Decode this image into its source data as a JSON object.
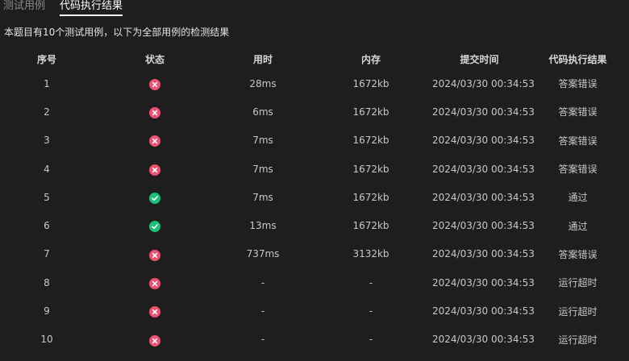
{
  "tabs": [
    {
      "label": "测试用例",
      "active": false
    },
    {
      "label": "代码执行结果",
      "active": true
    }
  ],
  "summary": "本题目有10个测试用例，以下为全部用例的检测结果",
  "columns": [
    "序号",
    "状态",
    "用时",
    "内存",
    "提交时间",
    "代码执行结果"
  ],
  "rows": [
    {
      "index": "1",
      "status": "fail",
      "time": "28ms",
      "memory": "1672kb",
      "submitted": "2024/03/30 00:34:53",
      "result": "答案错误"
    },
    {
      "index": "2",
      "status": "fail",
      "time": "6ms",
      "memory": "1672kb",
      "submitted": "2024/03/30 00:34:53",
      "result": "答案错误"
    },
    {
      "index": "3",
      "status": "fail",
      "time": "7ms",
      "memory": "1672kb",
      "submitted": "2024/03/30 00:34:53",
      "result": "答案错误"
    },
    {
      "index": "4",
      "status": "fail",
      "time": "7ms",
      "memory": "1672kb",
      "submitted": "2024/03/30 00:34:53",
      "result": "答案错误"
    },
    {
      "index": "5",
      "status": "pass",
      "time": "7ms",
      "memory": "1672kb",
      "submitted": "2024/03/30 00:34:53",
      "result": "通过"
    },
    {
      "index": "6",
      "status": "pass",
      "time": "13ms",
      "memory": "1672kb",
      "submitted": "2024/03/30 00:34:53",
      "result": "通过"
    },
    {
      "index": "7",
      "status": "fail",
      "time": "737ms",
      "memory": "3132kb",
      "submitted": "2024/03/30 00:34:53",
      "result": "答案错误"
    },
    {
      "index": "8",
      "status": "fail",
      "time": "-",
      "memory": "-",
      "submitted": "2024/03/30 00:34:53",
      "result": "运行超时"
    },
    {
      "index": "9",
      "status": "fail",
      "time": "-",
      "memory": "-",
      "submitted": "2024/03/30 00:34:53",
      "result": "运行超时"
    },
    {
      "index": "10",
      "status": "fail",
      "time": "-",
      "memory": "-",
      "submitted": "2024/03/30 00:34:53",
      "result": "运行超时"
    }
  ],
  "colors": {
    "fail": "#f0506e",
    "pass": "#1bbf7a",
    "background": "#1e1e1e"
  }
}
